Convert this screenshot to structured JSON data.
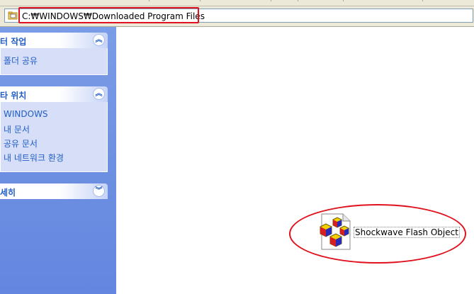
{
  "address_bar": {
    "path": "C:₩WINDOWS₩Downloaded Program Files"
  },
  "sidebar": {
    "panels": [
      {
        "title": "터 작업",
        "expanded": true,
        "items": [
          "폴더 공유"
        ]
      },
      {
        "title": "타 위치",
        "expanded": true,
        "items": [
          "WINDOWS",
          "내 문서",
          "공유 문서",
          "내 네트워크 환경"
        ]
      },
      {
        "title": "세히",
        "expanded": false,
        "items": []
      }
    ]
  },
  "main": {
    "files": [
      {
        "name": "Shockwave Flash Object",
        "icon": "activex-control-icon"
      }
    ]
  },
  "colors": {
    "highlight_red": "#e0121e",
    "sidebar_blue": "#6c8ee1",
    "link_blue": "#215dc6",
    "panel_body": "#d6dff7"
  }
}
